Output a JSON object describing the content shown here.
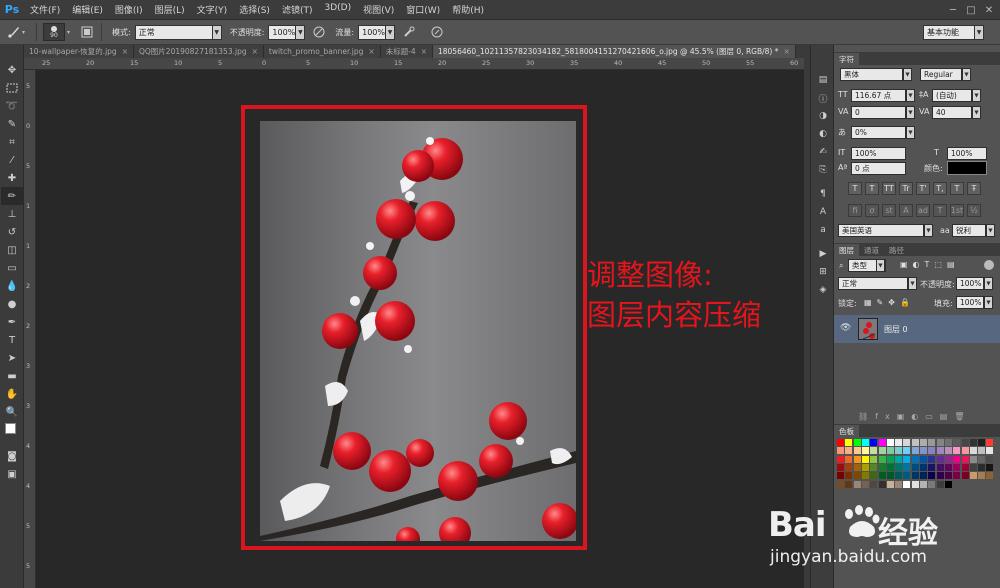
{
  "menu": {
    "logo": "Ps",
    "items": [
      "文件(F)",
      "编辑(E)",
      "图像(I)",
      "图层(L)",
      "文字(Y)",
      "选择(S)",
      "滤镜(T)",
      "3D(D)",
      "视图(V)",
      "窗口(W)",
      "帮助(H)"
    ],
    "window_controls": [
      "─",
      "□",
      "✕"
    ]
  },
  "options": {
    "brush_size": "90",
    "mode_label": "模式:",
    "mode_value": "正常",
    "opacity_label": "不透明度:",
    "opacity_value": "100%",
    "flow_label": "流量:",
    "flow_value": "100%",
    "workspace": "基本功能"
  },
  "tabs": [
    {
      "label": "10-wallpaper-恢复的.jpg",
      "active": false
    },
    {
      "label": "QQ图片20190827181353.jpg",
      "active": false
    },
    {
      "label": "twitch_promo_banner.jpg",
      "active": false
    },
    {
      "label": "未标题-4",
      "active": false
    },
    {
      "label": "18056460_10211357823034182_5818004151270421606_o.jpg @ 45.5% (图层 0, RGB/8) *",
      "active": true
    }
  ],
  "ruler": {
    "h_labels": [
      "25",
      "20",
      "15",
      "10",
      "5",
      "0",
      "5",
      "10",
      "15",
      "20",
      "25",
      "30",
      "35",
      "40",
      "45",
      "50",
      "55",
      "60"
    ],
    "v_labels": [
      "5",
      "0",
      "5",
      "1",
      "1",
      "2",
      "2",
      "3",
      "3",
      "4",
      "4",
      "5",
      "5"
    ]
  },
  "annotation": {
    "line1": "调整图像:",
    "line2": "图层内容压缩"
  },
  "character_panel": {
    "tabs": [
      "字符"
    ],
    "font_family": "黑体",
    "font_style": "Regular",
    "font_size": "116.67 点",
    "leading": "(自动)",
    "kerning": "0",
    "tracking": "40",
    "scale_label": "0%",
    "vertical_scale": "100%",
    "horizontal_scale": "100%",
    "baseline": "0 点",
    "color_label": "颜色:",
    "text_color": "#000000",
    "style_buttons": [
      "T",
      "T",
      "TT",
      "Tr",
      "T'",
      "T,",
      "T",
      "Ŧ"
    ],
    "opentype_buttons": [
      "fi",
      "ơ",
      "st",
      "A",
      "ad",
      "T",
      "1st",
      "½"
    ],
    "language": "美国英语",
    "antialias": "锐利"
  },
  "layers_panel": {
    "tabs": [
      "图层",
      "通道",
      "路径"
    ],
    "filter_label": "类型",
    "blend_mode": "正常",
    "opacity_label": "不透明度:",
    "opacity_value": "100%",
    "lock_label": "锁定:",
    "fill_label": "填充:",
    "fill_value": "100%",
    "layer_name": "图层 0"
  },
  "swatches_panel": {
    "tabs": [
      "色板"
    ],
    "colors": [
      "#ff0000",
      "#ffff00",
      "#00ff00",
      "#00ffff",
      "#0000ff",
      "#ff00ff",
      "#ffffff",
      "#ebebeb",
      "#d6d6d6",
      "#c2c2c2",
      "#adadad",
      "#999999",
      "#858585",
      "#707070",
      "#5c5c5c",
      "#474747",
      "#333333",
      "#1f1f1f",
      "#ff3b30",
      "#f7977a",
      "#f9ad81",
      "#fdc68a",
      "#fff79a",
      "#c4df9b",
      "#a3d39c",
      "#82ca9d",
      "#7bcdc8",
      "#6ecff6",
      "#7ea7d8",
      "#8493ca",
      "#8882be",
      "#a187be",
      "#bc8dbf",
      "#f49ac2",
      "#f6989d",
      "#d9d9d9",
      "#bfbfbf",
      "#e6e6e6",
      "#ed1c24",
      "#f26522",
      "#f7941d",
      "#fff200",
      "#8dc63f",
      "#39b54a",
      "#00a651",
      "#00a99d",
      "#00aeef",
      "#0072bc",
      "#0054a6",
      "#2e3192",
      "#662d91",
      "#92278f",
      "#ec008c",
      "#ed145b",
      "#8c8c8c",
      "#666666",
      "#4d4d4d",
      "#9e0b0f",
      "#a0410d",
      "#a36209",
      "#aba000",
      "#598527",
      "#1a7b30",
      "#007236",
      "#00746b",
      "#0076a3",
      "#004b80",
      "#003471",
      "#1b1464",
      "#440e62",
      "#630460",
      "#9e005d",
      "#9e0039",
      "#404040",
      "#2b2b2b",
      "#161616",
      "#790000",
      "#7b2e00",
      "#7d4900",
      "#827b00",
      "#406618",
      "#005e20",
      "#005826",
      "#005952",
      "#005b7f",
      "#003663",
      "#002157",
      "#0d004c",
      "#32004b",
      "#4b0049",
      "#7b0046",
      "#7a0026",
      "#c69c6d",
      "#a67c52",
      "#8c6239",
      "#754c24",
      "#603913",
      "#998675",
      "#736357",
      "#534741",
      "#362f2d",
      "#c7b299",
      "#998675",
      "#ffffff",
      "#e0e0e0",
      "#b3b3b3",
      "#7a7a7a",
      "#3d3d3d",
      "#000000"
    ]
  },
  "watermark": {
    "brand_left": "Bai",
    "brand_right": "经验",
    "url": "jingyan.baidu.com"
  }
}
